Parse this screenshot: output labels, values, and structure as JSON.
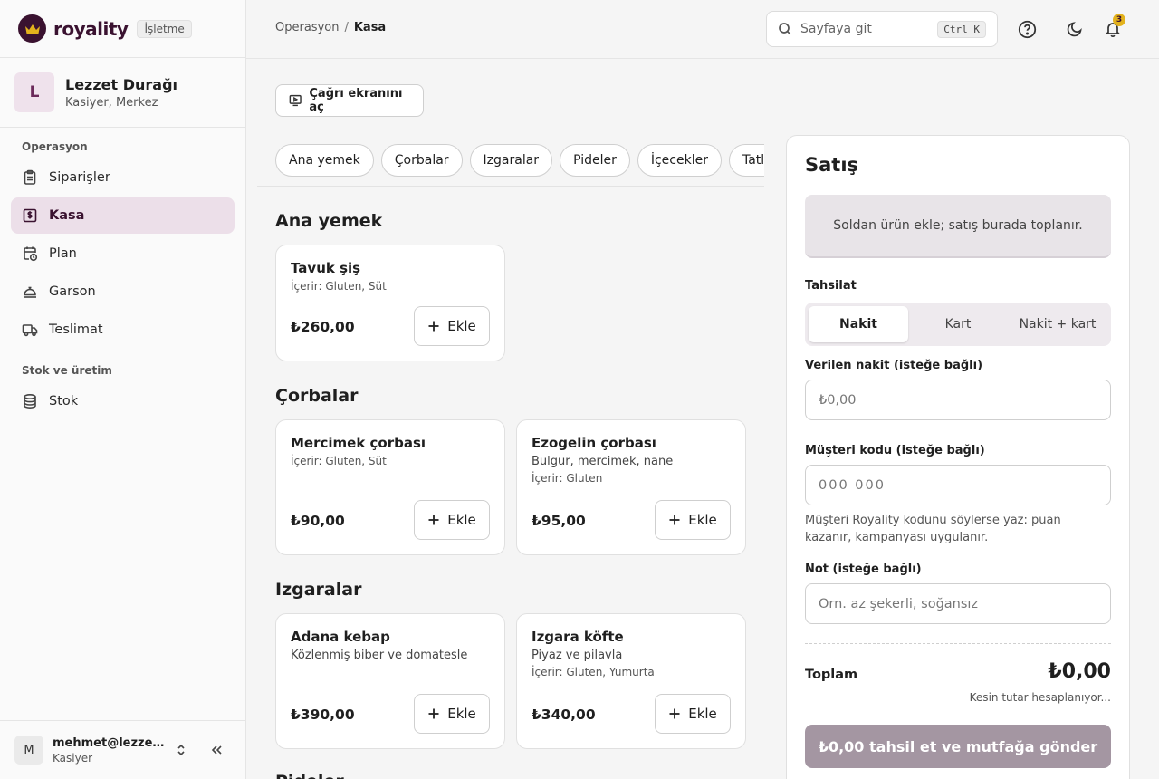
{
  "brand": {
    "name": "royality",
    "badge": "İşletme"
  },
  "org": {
    "initial": "L",
    "name": "Lezzet Durağı",
    "subtitle": "Kasiyer, Merkez"
  },
  "sidebar": {
    "sections": [
      {
        "title": "Operasyon",
        "items": [
          {
            "label": "Siparişler",
            "icon": "clipboard-icon"
          },
          {
            "label": "Kasa",
            "icon": "cash-register-icon",
            "active": true
          },
          {
            "label": "Plan",
            "icon": "calendar-clock-icon"
          },
          {
            "label": "Garson",
            "icon": "concierge-bell-icon"
          },
          {
            "label": "Teslimat",
            "icon": "truck-icon"
          }
        ]
      },
      {
        "title": "Stok ve üretim",
        "items": [
          {
            "label": "Stok",
            "icon": "database-icon"
          }
        ]
      }
    ]
  },
  "user": {
    "initial": "M",
    "email": "mehmet@lezzetdurağı.com",
    "role": "Kasiyer"
  },
  "header": {
    "breadcrumb": [
      "Operasyon",
      "Kasa"
    ],
    "separator": "/",
    "search_placeholder": "Sayfaya git",
    "shortcut": "Ctrl K",
    "notification_count": "3"
  },
  "main": {
    "call_screen_label": "Çağrı ekranını aç",
    "categories": [
      "Ana yemek",
      "Çorbalar",
      "Izgaralar",
      "Pideler",
      "İçecekler",
      "Tatlılar"
    ],
    "sections": [
      {
        "title": "Ana yemek",
        "products": [
          {
            "name": "Tavuk şiş",
            "desc": "",
            "allergens": "İçerir: Gluten, Süt",
            "price": "₺260,00"
          }
        ]
      },
      {
        "title": "Çorbalar",
        "products": [
          {
            "name": "Mercimek çorbası",
            "desc": "",
            "allergens": "İçerir: Gluten, Süt",
            "price": "₺90,00"
          },
          {
            "name": "Ezogelin çorbası",
            "desc": "Bulgur, mercimek, nane",
            "allergens": "İçerir: Gluten",
            "price": "₺95,00"
          }
        ]
      },
      {
        "title": "Izgaralar",
        "products": [
          {
            "name": "Adana kebap",
            "desc": "Közlenmiş biber ve domatesle",
            "allergens": "",
            "price": "₺390,00"
          },
          {
            "name": "Izgara köfte",
            "desc": "Piyaz ve pilavla",
            "allergens": "İçerir: Gluten, Yumurta",
            "price": "₺340,00"
          }
        ]
      },
      {
        "title": "Pideler",
        "products": []
      }
    ],
    "add_label": "Ekle"
  },
  "sale": {
    "title": "Satış",
    "empty_text": "Soldan ürün ekle; satış burada toplanır.",
    "payment_label": "Tahsilat",
    "payment_options": [
      "Nakit",
      "Kart",
      "Nakit + kart"
    ],
    "payment_selected": "Nakit",
    "cash_label": "Verilen nakit (isteğe bağlı)",
    "cash_placeholder": "₺0,00",
    "customer_label": "Müşteri kodu (isteğe bağlı)",
    "customer_placeholder": "000 000",
    "customer_hint": "Müşteri Royality kodunu söylerse yaz: puan kazanır, kampanyası uygulanır.",
    "note_label": "Not (isteğe bağlı)",
    "note_placeholder": "Örn. az şekerli, soğansız",
    "total_label": "Toplam",
    "total_value": "₺0,00",
    "total_sub": "Kesin tutar hesaplanıyor...",
    "submit_label": "₺0,00 tahsil et ve mutfağa gönder"
  },
  "colors": {
    "brand": "#3a1230",
    "accent_badge": "#e3b21c",
    "active_nav": "#ecdfe9",
    "submit_disabled": "#a496a2"
  }
}
